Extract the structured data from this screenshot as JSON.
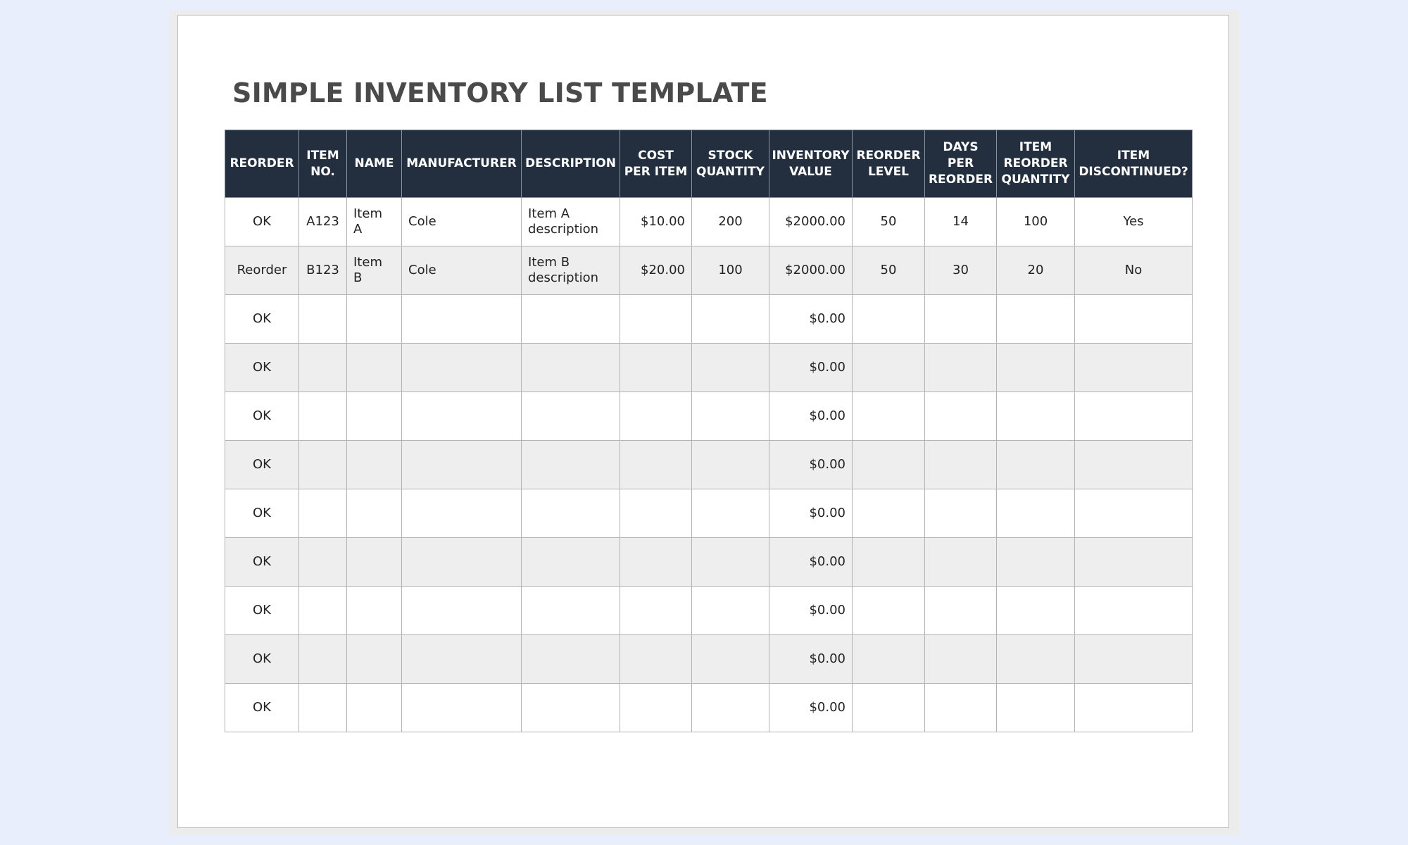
{
  "document": {
    "title": "SIMPLE INVENTORY LIST TEMPLATE"
  },
  "table": {
    "headers": {
      "reorder": [
        "REORDER"
      ],
      "item_no": [
        "ITEM",
        "NO."
      ],
      "name": [
        "NAME"
      ],
      "manufacturer": [
        "MANUFACTURER"
      ],
      "description": [
        "DESCRIPTION"
      ],
      "cost_per_item": [
        "COST",
        "PER ITEM"
      ],
      "stock_quantity": [
        "STOCK",
        "QUANTITY"
      ],
      "inventory_value": [
        "INVENTORY",
        "VALUE"
      ],
      "reorder_level": [
        "REORDER",
        "LEVEL"
      ],
      "days_per_reorder": [
        "DAYS",
        "PER",
        "REORDER"
      ],
      "item_reorder_quantity": [
        "ITEM",
        "REORDER",
        "QUANTITY"
      ],
      "item_discontinued": [
        "ITEM",
        "DISCONTINUED?"
      ]
    },
    "rows": [
      {
        "reorder": "OK",
        "item_no": "A123",
        "name": [
          "Item",
          "A"
        ],
        "manufacturer": "Cole",
        "description": [
          "Item A",
          "description"
        ],
        "cost_per_item": "$10.00",
        "stock_quantity": "200",
        "inventory_value": "$2000.00",
        "reorder_level": "50",
        "days_per_reorder": "14",
        "item_reorder_quantity": "100",
        "item_discontinued": "Yes"
      },
      {
        "reorder": "Reorder",
        "item_no": "B123",
        "name": [
          "Item B"
        ],
        "manufacturer": "Cole",
        "description": [
          "Item B",
          "description"
        ],
        "cost_per_item": "$20.00",
        "stock_quantity": "100",
        "inventory_value": "$2000.00",
        "reorder_level": "50",
        "days_per_reorder": "30",
        "item_reorder_quantity": "20",
        "item_discontinued": "No"
      },
      {
        "reorder": "OK",
        "inventory_value": "$0.00"
      },
      {
        "reorder": "OK",
        "inventory_value": "$0.00"
      },
      {
        "reorder": "OK",
        "inventory_value": "$0.00"
      },
      {
        "reorder": "OK",
        "inventory_value": "$0.00"
      },
      {
        "reorder": "OK",
        "inventory_value": "$0.00"
      },
      {
        "reorder": "OK",
        "inventory_value": "$0.00"
      },
      {
        "reorder": "OK",
        "inventory_value": "$0.00"
      },
      {
        "reorder": "OK",
        "inventory_value": "$0.00"
      },
      {
        "reorder": "OK",
        "inventory_value": "$0.00"
      }
    ]
  }
}
